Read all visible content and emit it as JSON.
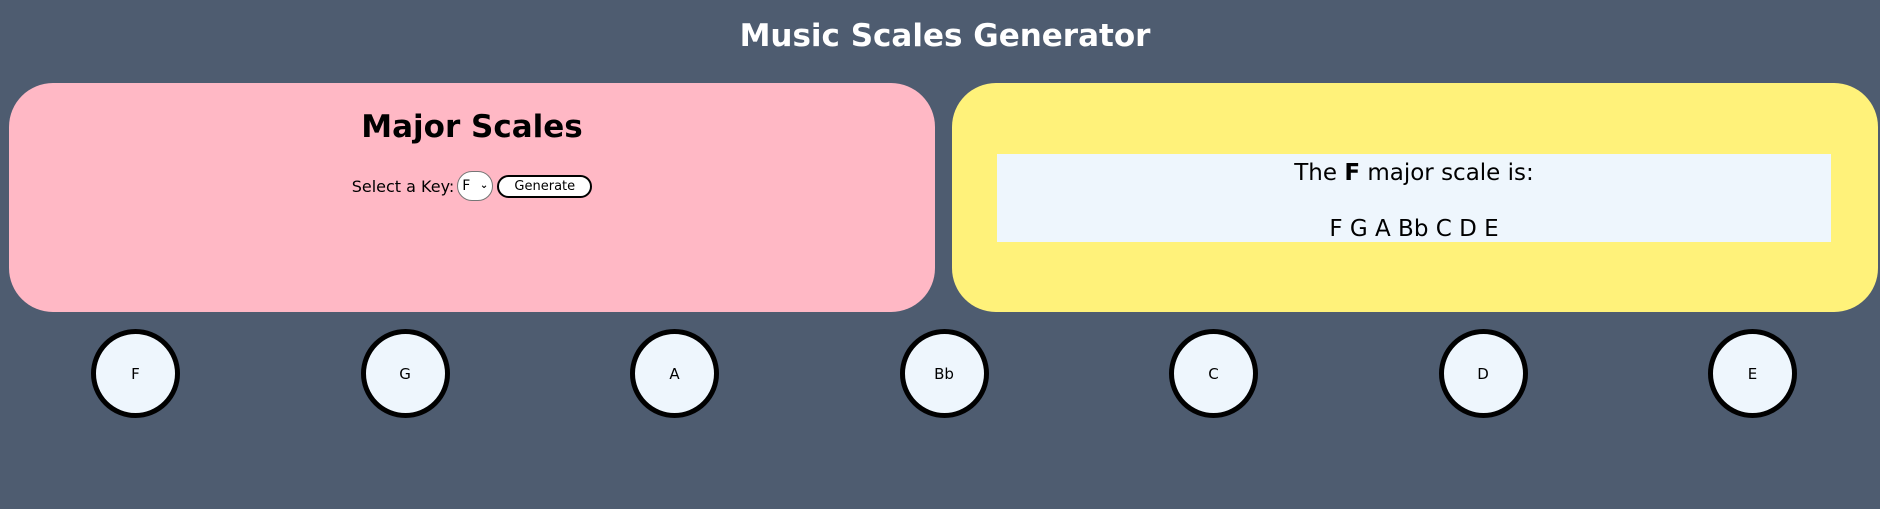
{
  "page": {
    "title": "Music Scales Generator"
  },
  "left_panel": {
    "heading": "Major Scales",
    "select_label": "Select a Key:",
    "selected_key": "F",
    "generate_label": "Generate"
  },
  "right_panel": {
    "prefix": "The ",
    "key": "F",
    "suffix": " major scale is:",
    "notes_text": "F G A Bb C D E"
  },
  "notes": [
    "F",
    "G",
    "A",
    "Bb",
    "C",
    "D",
    "E"
  ],
  "colors": {
    "background": "#4e5c70",
    "left_panel": "#ffb8c5",
    "right_panel": "#fff27a",
    "result_box": "#eef6fd"
  }
}
